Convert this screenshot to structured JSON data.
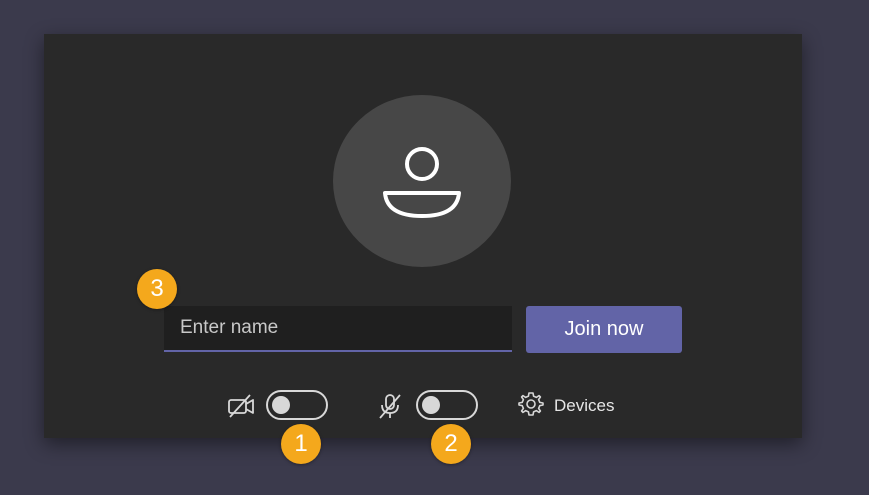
{
  "join_form": {
    "name_placeholder": "Enter name",
    "name_value": "",
    "join_label": "Join now"
  },
  "controls": {
    "camera_icon": "camera-off-icon",
    "camera_on": false,
    "mic_icon": "microphone-off-icon",
    "mic_on": false,
    "devices_icon": "gear-icon",
    "devices_label": "Devices"
  },
  "callouts": {
    "camera_toggle": "1",
    "mic_toggle": "2",
    "name_field": "3"
  },
  "colors": {
    "background": "#3b3a4c",
    "panel": "#292929",
    "avatar": "#474747",
    "accent": "#6264a7",
    "badge": "#f4a81c"
  }
}
